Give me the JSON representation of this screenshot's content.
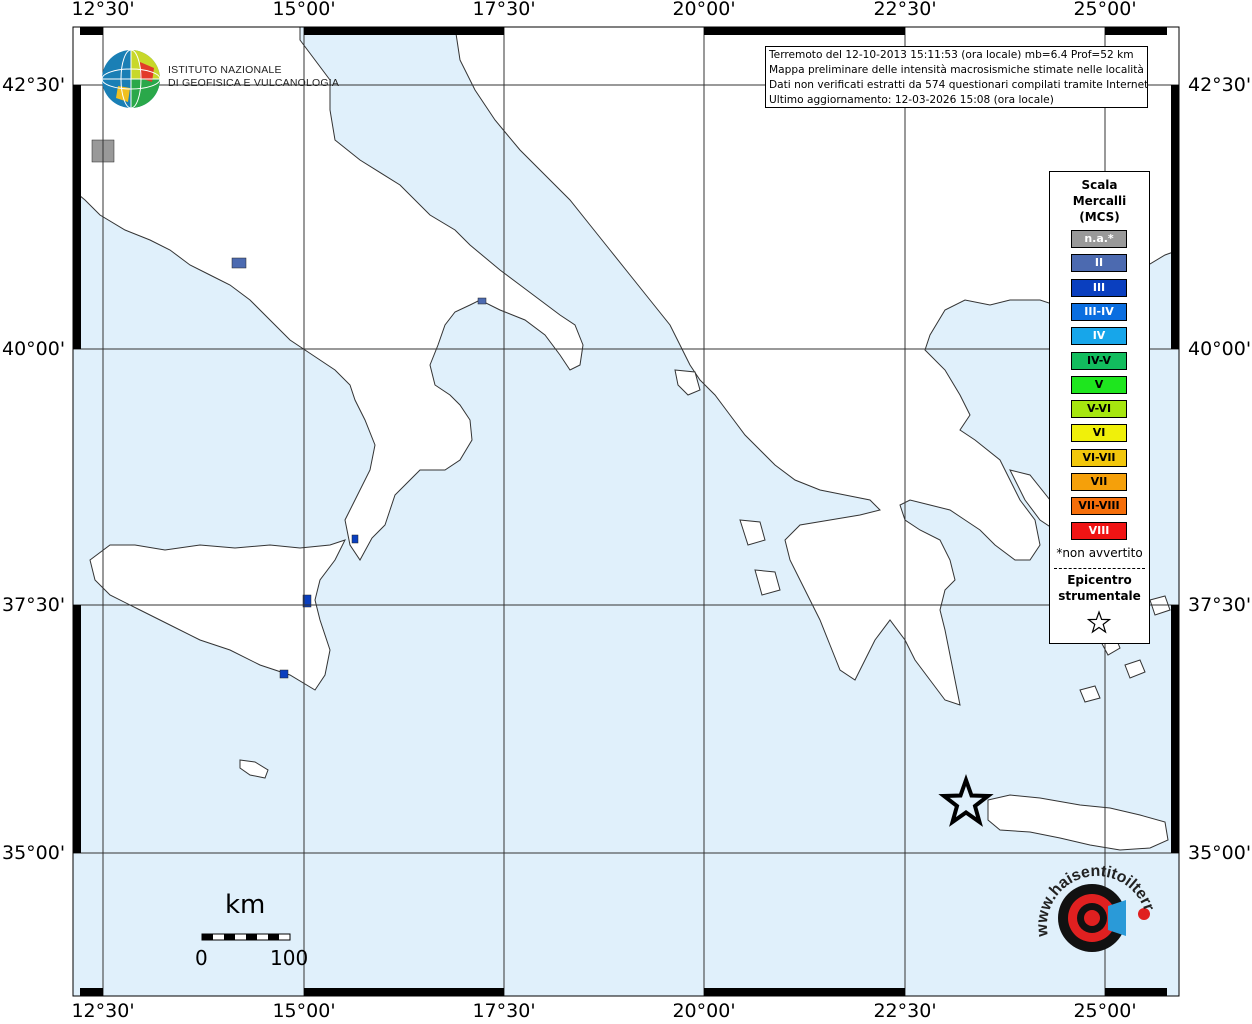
{
  "map": {
    "top_ticks": [
      "12°30'",
      "15°00'",
      "17°30'",
      "20°00'",
      "22°30'",
      "25°00'"
    ],
    "bottom_ticks": [
      "12°30'",
      "15°00'",
      "17°30'",
      "20°00'",
      "22°30'",
      "25°00'"
    ],
    "left_ticks": [
      "42°30'",
      "40°00'",
      "37°30'",
      "35°00'"
    ],
    "right_ticks": [
      "42°30'",
      "40°00'",
      "37°30'",
      "35°00'"
    ],
    "sea_color": "#e0f0fb",
    "land_color": "#ffffff"
  },
  "info": {
    "line1": "Terremoto del 12-10-2013 15:11:53 (ora locale) mb=6.4 Prof=52 km",
    "line2": "Mappa preliminare delle intensità macrosismiche stimate nelle località",
    "line3": "Dati non verificati estratti da 574 questionari compilati tramite Internet.",
    "line4": "Ultimo aggiornamento: 12-03-2026 15:08 (ora locale)"
  },
  "logo": {
    "line1": "ISTITUTO NAZIONALE",
    "line2": "DI GEOFISICA E VULCANOLOGIA"
  },
  "legend": {
    "title1": "Scala",
    "title2": "Mercalli",
    "title3": "(MCS)",
    "levels": [
      {
        "label": "n.a.*",
        "color": "#999999",
        "text_color": "#ffffff"
      },
      {
        "label": "II",
        "color": "#4c6ab0",
        "text_color": "#ffffff"
      },
      {
        "label": "III",
        "color": "#0a3fbf",
        "text_color": "#ffffff"
      },
      {
        "label": "III-IV",
        "color": "#0a6ee0",
        "text_color": "#ffffff"
      },
      {
        "label": "IV",
        "color": "#17a6ea",
        "text_color": "#ffffff"
      },
      {
        "label": "IV-V",
        "color": "#12bd5e",
        "text_color": "#000000"
      },
      {
        "label": "V",
        "color": "#1ee61e",
        "text_color": "#000000"
      },
      {
        "label": "V-VI",
        "color": "#a6e60f",
        "text_color": "#000000"
      },
      {
        "label": "VI",
        "color": "#f0f00a",
        "text_color": "#000000"
      },
      {
        "label": "VI-VII",
        "color": "#f2c70c",
        "text_color": "#000000"
      },
      {
        "label": "VII",
        "color": "#f5a00a",
        "text_color": "#000000"
      },
      {
        "label": "VII-VIII",
        "color": "#f56e0a",
        "text_color": "#000000"
      },
      {
        "label": "VIII",
        "color": "#f01414",
        "text_color": "#ffffff"
      }
    ],
    "na_note": "*non avvertito",
    "epicenter1": "Epicentro",
    "epicenter2": "strumentale",
    "epicenter_icon": "star-icon"
  },
  "scale": {
    "unit": "km",
    "start": "0",
    "end": "100"
  },
  "hsit": {
    "text": "www.haisentitoilterremoto.it"
  }
}
